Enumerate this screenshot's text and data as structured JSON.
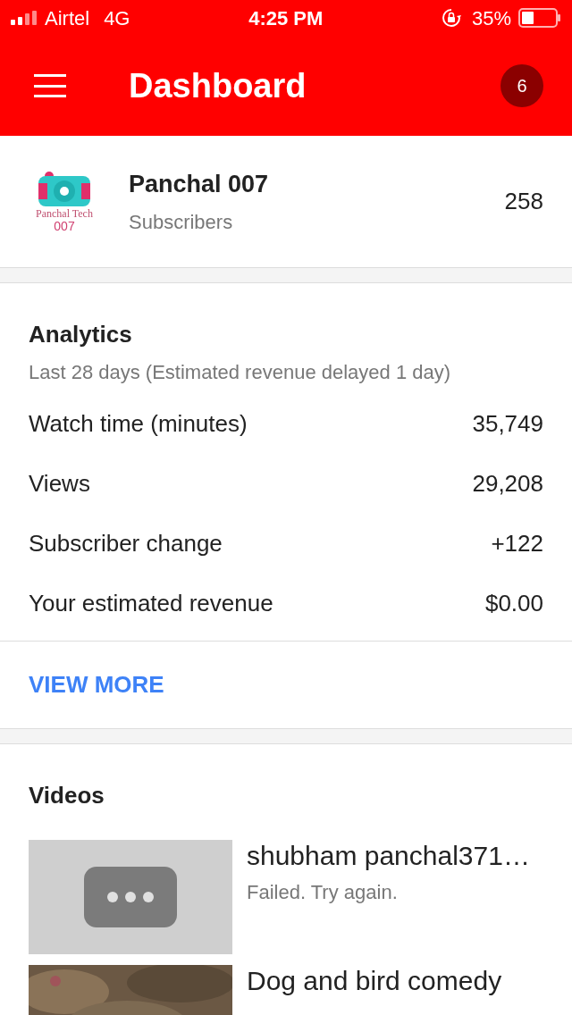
{
  "status_bar": {
    "carrier": "Airtel",
    "network": "4G",
    "time": "4:25 PM",
    "battery": "35%"
  },
  "app_bar": {
    "title": "Dashboard",
    "notifications": "6"
  },
  "channel": {
    "logo_text": "Panchal Tech",
    "logo_number": "007",
    "name": "Panchal 007",
    "subtitle": "Subscribers",
    "count": "258"
  },
  "analytics": {
    "title": "Analytics",
    "subtitle": "Last 28 days (Estimated revenue delayed 1 day)",
    "rows": [
      {
        "label": "Watch time (minutes)",
        "value": "35,749"
      },
      {
        "label": "Views",
        "value": "29,208"
      },
      {
        "label": "Subscriber change",
        "value": "+122"
      },
      {
        "label": "Your estimated revenue",
        "value": "$0.00"
      }
    ],
    "link": "VIEW MORE"
  },
  "videos": {
    "title": "Videos",
    "items": [
      {
        "kind": "placeholder",
        "title": "shubham panchal371…",
        "status": "Failed. Try again."
      },
      {
        "kind": "picture",
        "title": "Dog and bird comedy"
      }
    ]
  }
}
